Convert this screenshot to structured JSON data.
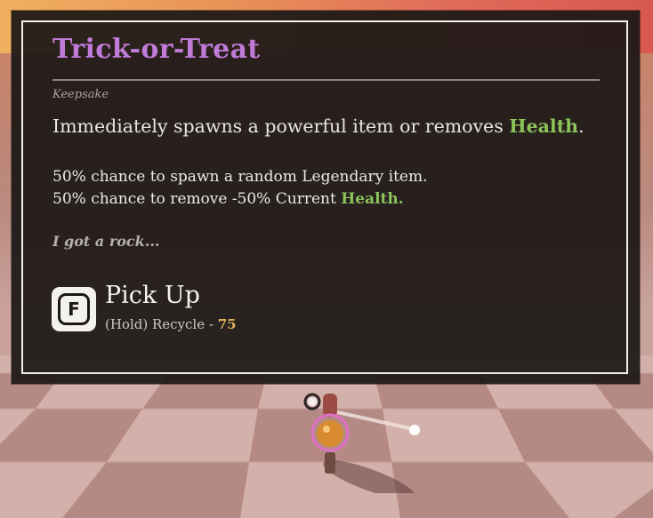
{
  "tooltip": {
    "title": "Trick-or-Treat",
    "category": "Keepsake",
    "description_prefix": "Immediately spawns a powerful item or removes ",
    "description_highlight": "Health",
    "description_suffix": ".",
    "detail_line_1": "50% chance to spawn a random Legendary item.",
    "detail_line_2_prefix": "50% chance to remove -50% Current ",
    "detail_line_2_highlight": "Health.",
    "flavor_text": "I got a rock...",
    "interaction": {
      "key": "F",
      "action_label": "Pick Up",
      "secondary_prefix": "(Hold) Recycle - ",
      "secondary_cost": "75"
    }
  },
  "colors": {
    "title": "#c07ad8",
    "highlight": "#8cc45a",
    "cost": "#e0b35a",
    "panel_bg": "#1c1817",
    "border": "#f2efe9"
  },
  "icons": {
    "key_prompt": "keyboard-key-f-icon",
    "character": "player-character-icon"
  }
}
